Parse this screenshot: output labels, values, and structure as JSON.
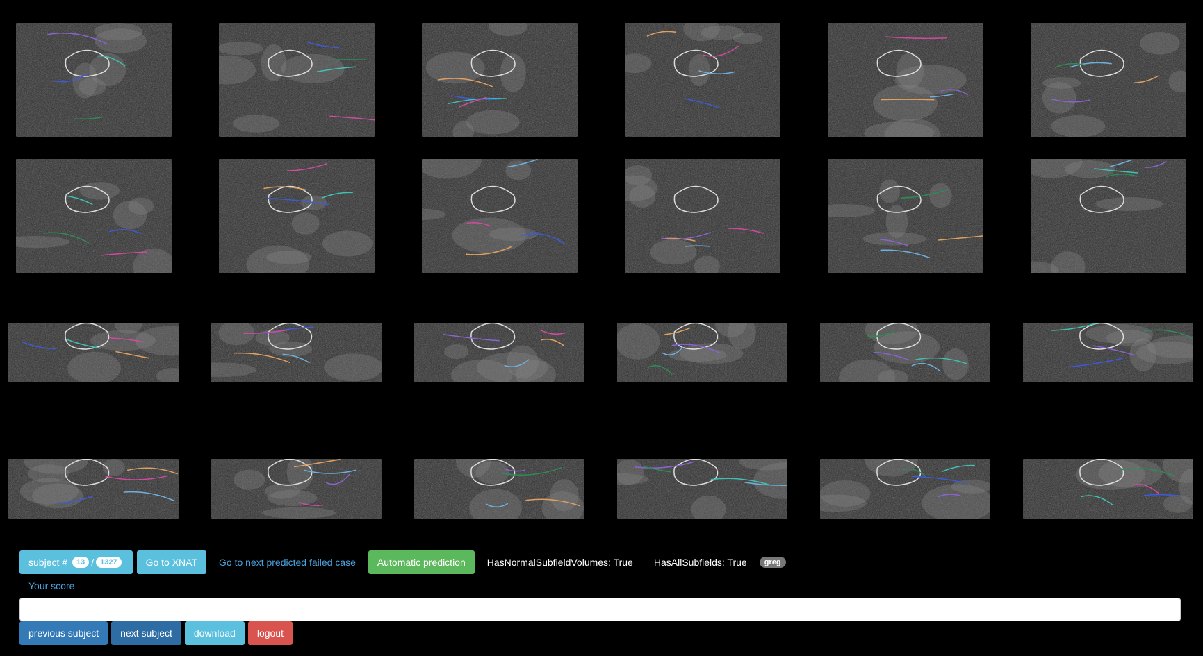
{
  "toolbar": {
    "subject_label": "subject #",
    "subject_index": "13",
    "subject_separator": "/",
    "subject_total": "1327",
    "go_to_xnat": "Go to XNAT",
    "next_failed_link": "Go to next predicted failed case",
    "automatic_prediction": "Automatic prediction",
    "normal_volumes": "HasNormalSubfieldVolumes: True",
    "all_subfields": "HasAllSubfields: True",
    "user_badge": "greg"
  },
  "score": {
    "label": "Your score",
    "value": "",
    "placeholder": ""
  },
  "actions": {
    "previous": "previous subject",
    "next": "next subject",
    "download": "download",
    "logout": "logout"
  },
  "colors": {
    "info": "#5bc0de",
    "success": "#5cb85c",
    "primary": "#337ab7",
    "danger": "#d9534f",
    "link": "#4aa3df"
  },
  "thumbnails": {
    "coronal_row_1": 6,
    "coronal_row_2": 6,
    "sagittal_row_1": 6,
    "sagittal_row_2": 6
  }
}
